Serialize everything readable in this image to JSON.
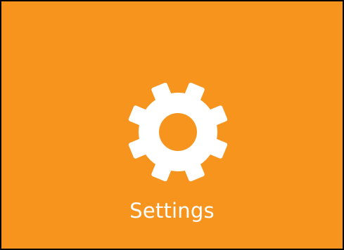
{
  "tile": {
    "label": "Settings",
    "icon": "gear-icon",
    "background_color": "#F7941D",
    "foreground_color": "#FFFFFF",
    "border_color": "#000000"
  }
}
